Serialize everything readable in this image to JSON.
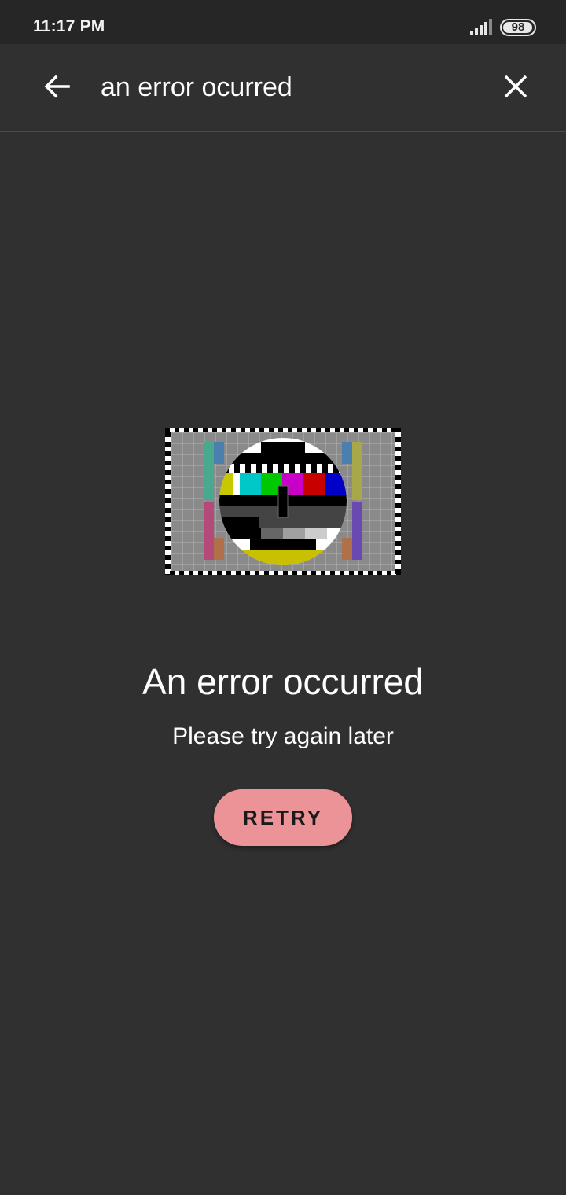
{
  "status_bar": {
    "time": "11:17 PM",
    "battery_level": "98",
    "battery_fraction": 0.98,
    "signal_icon": "signal-bars-icon"
  },
  "app_bar": {
    "back_icon": "arrow-left-icon",
    "search_query": "an error ocurred",
    "close_icon": "close-icon"
  },
  "error": {
    "illustration": "tv-test-card-image",
    "title": "An error occurred",
    "subtitle": "Please try again later",
    "retry_label": "RETRY"
  },
  "colors": {
    "background": "#303030",
    "status_bar": "#262626",
    "retry_button": "#ec9398",
    "text": "#ffffff"
  }
}
